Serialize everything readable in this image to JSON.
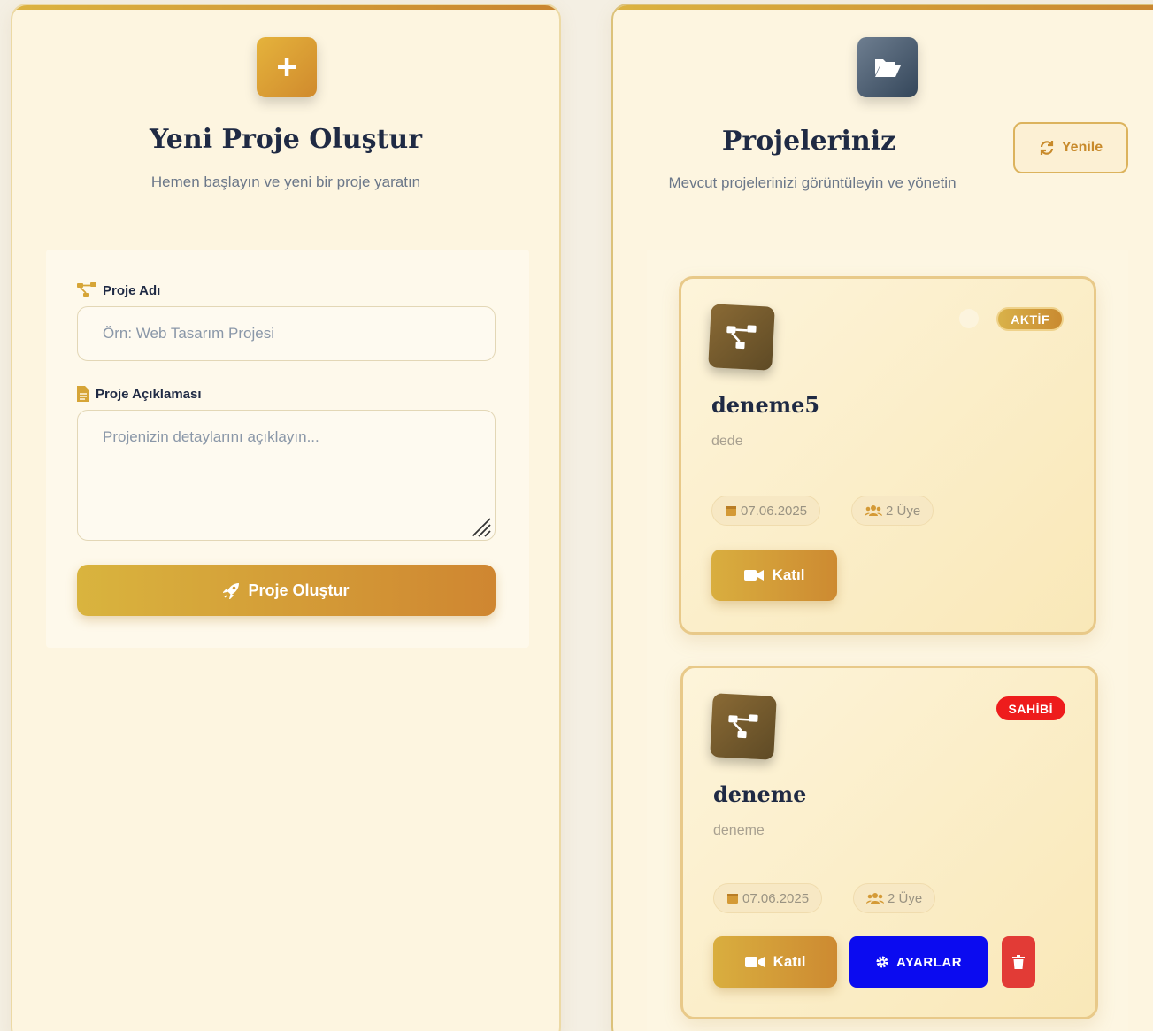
{
  "create_panel": {
    "title": "Yeni Proje Oluştur",
    "subtitle": "Hemen başlayın ve yeni bir proje yaratın",
    "name_label": "Proje Adı",
    "name_placeholder": "Örn: Web Tasarım Projesi",
    "desc_label": "Proje Açıklaması",
    "desc_placeholder": "Projenizin detaylarını açıklayın...",
    "create_button": "Proje Oluştur"
  },
  "projects_panel": {
    "title": "Projeleriniz",
    "subtitle": "Mevcut projelerinizi görüntüleyin ve yönetin",
    "refresh_button": "Yenile",
    "projects": [
      {
        "name": "deneme5",
        "description": "dede",
        "badge": "AKTİF",
        "date": "07.06.2025",
        "members": "2 Üye",
        "join_label": "Katıl"
      },
      {
        "name": "deneme",
        "description": "deneme",
        "badge": "SAHİBİ",
        "date": "07.06.2025",
        "members": "2 Üye",
        "join_label": "Katıl",
        "settings_label": "AYARLAR"
      }
    ]
  },
  "colors": {
    "accent_gold": "#d9b43e",
    "accent_orange": "#cf8631",
    "settings_blue": "#0b0bf0",
    "owner_red": "#ee1c1c",
    "title_navy": "#1f2a44"
  },
  "icons": {
    "create_tile": "plus-icon",
    "projects_tile": "folder-open-icon",
    "refresh": "refresh-icon",
    "project_name": "project-diagram-icon",
    "description": "file-icon",
    "create": "rocket-icon",
    "date": "calendar-icon",
    "members": "users-icon",
    "join": "video-icon",
    "settings": "gear-icon",
    "delete": "trash-icon"
  }
}
